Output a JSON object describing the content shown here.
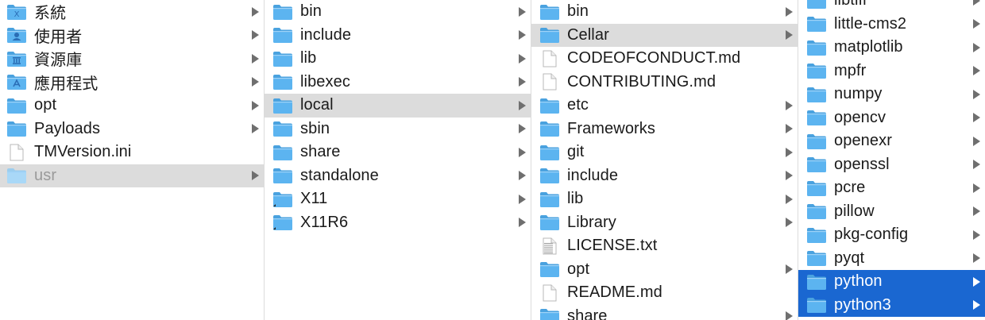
{
  "columns": [
    {
      "id": "c1",
      "items": [
        {
          "name": "系統",
          "icon": "folder-system-icon",
          "arrow": true
        },
        {
          "name": "使用者",
          "icon": "folder-users-icon",
          "arrow": true
        },
        {
          "name": "資源庫",
          "icon": "folder-library-icon",
          "arrow": true
        },
        {
          "name": "應用程式",
          "icon": "folder-applications-icon",
          "arrow": true
        },
        {
          "name": "opt",
          "icon": "folder-icon",
          "arrow": true
        },
        {
          "name": "Payloads",
          "icon": "folder-icon",
          "arrow": true
        },
        {
          "name": "TMVersion.ini",
          "icon": "document-icon",
          "arrow": false
        },
        {
          "name": "usr",
          "icon": "folder-dim-icon",
          "arrow": true,
          "state": "sel-grey dim"
        }
      ]
    },
    {
      "id": "c2",
      "items": [
        {
          "name": "bin",
          "icon": "folder-icon",
          "arrow": true
        },
        {
          "name": "include",
          "icon": "folder-icon",
          "arrow": true
        },
        {
          "name": "lib",
          "icon": "folder-icon",
          "arrow": true
        },
        {
          "name": "libexec",
          "icon": "folder-icon",
          "arrow": true
        },
        {
          "name": "local",
          "icon": "folder-icon",
          "arrow": true,
          "state": "sel-grey"
        },
        {
          "name": "sbin",
          "icon": "folder-icon",
          "arrow": true
        },
        {
          "name": "share",
          "icon": "folder-icon",
          "arrow": true
        },
        {
          "name": "standalone",
          "icon": "folder-icon",
          "arrow": true
        },
        {
          "name": "X11",
          "icon": "folder-alias-icon",
          "arrow": true
        },
        {
          "name": "X11R6",
          "icon": "folder-alias-icon",
          "arrow": true
        }
      ]
    },
    {
      "id": "c3",
      "items": [
        {
          "name": "bin",
          "icon": "folder-icon",
          "arrow": true
        },
        {
          "name": "Cellar",
          "icon": "folder-icon",
          "arrow": true,
          "state": "sel-grey"
        },
        {
          "name": "CODEOFCONDUCT.md",
          "icon": "document-icon",
          "arrow": false
        },
        {
          "name": "CONTRIBUTING.md",
          "icon": "document-icon",
          "arrow": false
        },
        {
          "name": "etc",
          "icon": "folder-icon",
          "arrow": true
        },
        {
          "name": "Frameworks",
          "icon": "folder-icon",
          "arrow": true
        },
        {
          "name": "git",
          "icon": "folder-icon",
          "arrow": true
        },
        {
          "name": "include",
          "icon": "folder-icon",
          "arrow": true
        },
        {
          "name": "lib",
          "icon": "folder-icon",
          "arrow": true
        },
        {
          "name": "Library",
          "icon": "folder-icon",
          "arrow": true
        },
        {
          "name": "LICENSE.txt",
          "icon": "text-document-icon",
          "arrow": false
        },
        {
          "name": "opt",
          "icon": "folder-icon",
          "arrow": true
        },
        {
          "name": "README.md",
          "icon": "document-icon",
          "arrow": false
        },
        {
          "name": "share",
          "icon": "folder-icon",
          "arrow": true
        }
      ]
    },
    {
      "id": "c4",
      "items": [
        {
          "name": "libtiff",
          "icon": "folder-icon",
          "arrow": true
        },
        {
          "name": "little-cms2",
          "icon": "folder-icon",
          "arrow": true
        },
        {
          "name": "matplotlib",
          "icon": "folder-icon",
          "arrow": true
        },
        {
          "name": "mpfr",
          "icon": "folder-icon",
          "arrow": true
        },
        {
          "name": "numpy",
          "icon": "folder-icon",
          "arrow": true
        },
        {
          "name": "opencv",
          "icon": "folder-icon",
          "arrow": true
        },
        {
          "name": "openexr",
          "icon": "folder-icon",
          "arrow": true
        },
        {
          "name": "openssl",
          "icon": "folder-icon",
          "arrow": true
        },
        {
          "name": "pcre",
          "icon": "folder-icon",
          "arrow": true
        },
        {
          "name": "pillow",
          "icon": "folder-icon",
          "arrow": true
        },
        {
          "name": "pkg-config",
          "icon": "folder-icon",
          "arrow": true
        },
        {
          "name": "pyqt",
          "icon": "folder-icon",
          "arrow": true
        },
        {
          "name": "python",
          "icon": "folder-icon",
          "arrow": true,
          "state": "sel-blue"
        },
        {
          "name": "python3",
          "icon": "folder-icon",
          "arrow": true,
          "state": "sel-blue"
        }
      ]
    }
  ]
}
